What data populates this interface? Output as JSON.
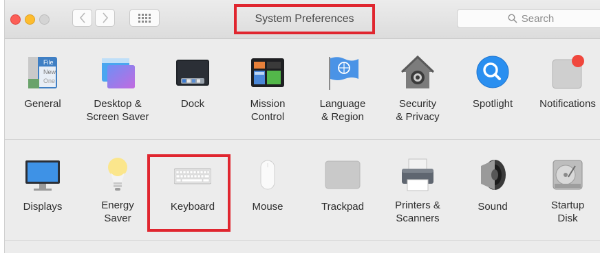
{
  "window": {
    "title": "System Preferences"
  },
  "search": {
    "placeholder": "Search"
  },
  "colors": {
    "highlight": "#e0262f",
    "close": "#fc5f57",
    "minimize": "#fdbc2e"
  },
  "rows": [
    {
      "items": [
        {
          "name": "general",
          "label1": "General",
          "label2": "",
          "icon": "general-icon"
        },
        {
          "name": "desktop-screen-saver",
          "label1": "Desktop &",
          "label2": "Screen Saver",
          "icon": "desktop-icon"
        },
        {
          "name": "dock",
          "label1": "Dock",
          "label2": "",
          "icon": "dock-icon"
        },
        {
          "name": "mission-control",
          "label1": "Mission",
          "label2": "Control",
          "icon": "mission-control-icon"
        },
        {
          "name": "language-region",
          "label1": "Language",
          "label2": "& Region",
          "icon": "globe-flag-icon"
        },
        {
          "name": "security-privacy",
          "label1": "Security",
          "label2": "& Privacy",
          "icon": "house-lock-icon"
        },
        {
          "name": "spotlight",
          "label1": "Spotlight",
          "label2": "",
          "icon": "magnifier-icon"
        },
        {
          "name": "notifications",
          "label1": "Notifications",
          "label2": "",
          "icon": "notifications-icon"
        }
      ]
    },
    {
      "items": [
        {
          "name": "displays",
          "label1": "Displays",
          "label2": "",
          "icon": "monitor-icon"
        },
        {
          "name": "energy-saver",
          "label1": "Energy",
          "label2": "Saver",
          "icon": "lightbulb-icon"
        },
        {
          "name": "keyboard",
          "label1": "Keyboard",
          "label2": "",
          "icon": "keyboard-icon"
        },
        {
          "name": "mouse",
          "label1": "Mouse",
          "label2": "",
          "icon": "mouse-icon"
        },
        {
          "name": "trackpad",
          "label1": "Trackpad",
          "label2": "",
          "icon": "trackpad-icon"
        },
        {
          "name": "printers-scanners",
          "label1": "Printers &",
          "label2": "Scanners",
          "icon": "printer-icon"
        },
        {
          "name": "sound",
          "label1": "Sound",
          "label2": "",
          "icon": "speaker-icon"
        },
        {
          "name": "startup-disk",
          "label1": "Startup",
          "label2": "Disk",
          "icon": "hard-disk-icon"
        }
      ]
    }
  ],
  "general_icon_text": [
    "File",
    "New",
    "One"
  ]
}
